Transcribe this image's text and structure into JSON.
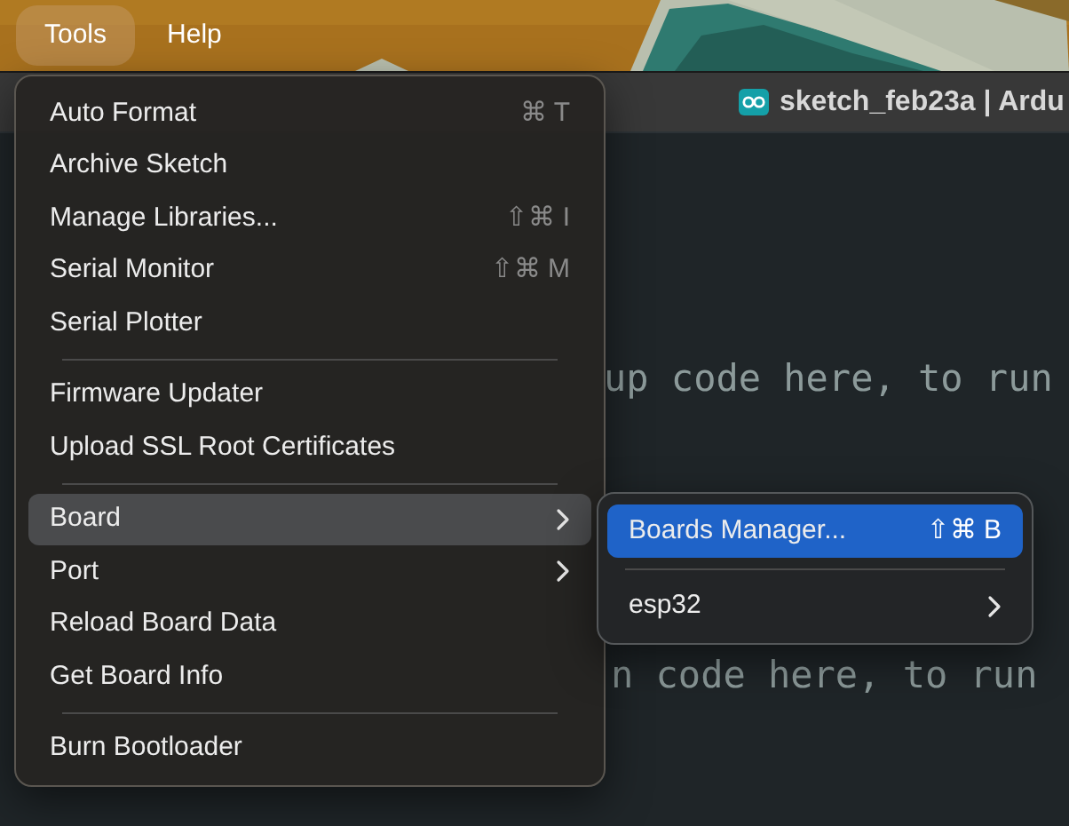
{
  "menu_bar": [
    {
      "label": "Tools",
      "selected": true
    },
    {
      "label": "Help",
      "selected": false
    }
  ],
  "window": {
    "title": "sketch_feb23a | Ardu"
  },
  "editor": {
    "lines": [
      {
        "text": "up code here, to run"
      },
      {
        "text": "n code here, to run"
      }
    ]
  },
  "menu": {
    "items": [
      {
        "kind": "item",
        "label": "Auto Format",
        "shortcut": "⌘ T",
        "selected": false
      },
      {
        "kind": "item",
        "label": "Archive Sketch",
        "selected": false
      },
      {
        "kind": "item",
        "label": "Manage Libraries...",
        "shortcut": "⇧⌘ I",
        "selected": false
      },
      {
        "kind": "item",
        "label": "Serial Monitor",
        "shortcut": "⇧⌘ M",
        "selected": false
      },
      {
        "kind": "item",
        "label": "Serial Plotter",
        "selected": false
      },
      {
        "kind": "separator"
      },
      {
        "kind": "item",
        "label": "Firmware Updater",
        "selected": false
      },
      {
        "kind": "item",
        "label": "Upload SSL Root Certificates",
        "selected": false
      },
      {
        "kind": "separator"
      },
      {
        "kind": "submenu",
        "label": "Board",
        "selected": true
      },
      {
        "kind": "submenu",
        "label": "Port",
        "selected": false
      },
      {
        "kind": "item",
        "label": "Reload Board Data",
        "selected": false
      },
      {
        "kind": "item",
        "label": "Get Board Info",
        "selected": false
      },
      {
        "kind": "separator"
      },
      {
        "kind": "item",
        "label": "Burn Bootloader",
        "selected": false
      }
    ]
  },
  "submenu": {
    "items": [
      {
        "kind": "item",
        "label": "Boards Manager...",
        "shortcut": "⇧⌘ B",
        "selected": true
      },
      {
        "kind": "separator"
      },
      {
        "kind": "submenu",
        "label": "esp32",
        "selected": false
      }
    ]
  }
}
